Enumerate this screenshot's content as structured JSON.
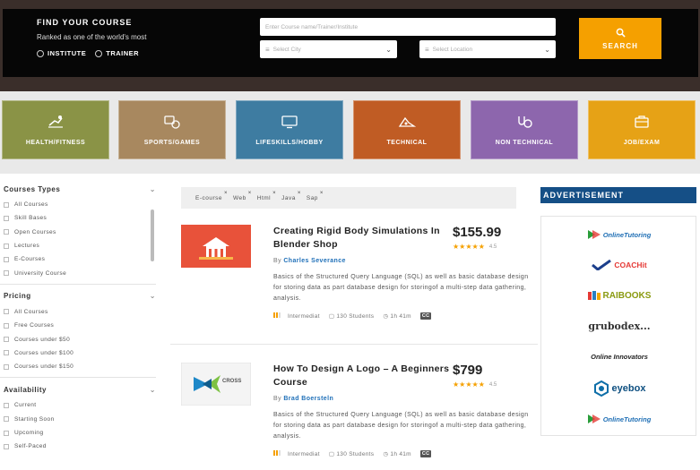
{
  "hero": {
    "title": "FIND YOUR COURSE",
    "subtitle": "Ranked as one of the world's most",
    "radios": [
      "INSTITUTE",
      "TRAINER"
    ],
    "course_placeholder": "Enter Course name/Trainer/Institute",
    "city_placeholder": "Select City",
    "location_placeholder": "Select Location",
    "search_label": "SEARCH"
  },
  "categories": [
    {
      "label": "HEALTH/FITNESS",
      "color": "#8a9346",
      "icon": "fitness-icon"
    },
    {
      "label": "SPORTS/GAMES",
      "color": "#a8885f",
      "icon": "sports-icon"
    },
    {
      "label": "LIFESKILLS/HOBBY",
      "color": "#3e7ca1",
      "icon": "monitor-icon"
    },
    {
      "label": "TECHNICAL",
      "color": "#c05c24",
      "icon": "technical-icon"
    },
    {
      "label": "NON TECHNICAL",
      "color": "#8d66ad",
      "icon": "non-technical-icon"
    },
    {
      "label": "JOB/EXAM",
      "color": "#e6a216",
      "icon": "job-icon"
    }
  ],
  "sidebar": {
    "sections": [
      {
        "title": "Courses Types",
        "items": [
          "All Courses",
          "Skill Bases",
          "Open Courses",
          "Lectures",
          "E-Courses",
          "University Course"
        ]
      },
      {
        "title": "Pricing",
        "items": [
          "All Courses",
          "Free Courses",
          "Courses under $50",
          "Courses under $100",
          "Courses under $150"
        ]
      },
      {
        "title": "Availability",
        "items": [
          "Current",
          "Starting Soon",
          "Upcoming",
          "Self-Paced"
        ]
      }
    ]
  },
  "tags": [
    "E-course",
    "Web",
    "Html",
    "Java",
    "Sap"
  ],
  "courses": [
    {
      "title": "Creating Rigid Body Simulations In Blender Shop",
      "price": "$155.99",
      "stars": "★★★★★",
      "rating": "4.5",
      "by_prefix": "By",
      "author": "Charles Severance",
      "description": "Basics of the Structured Query Language (SQL) as well as basic database design for storing data as part database design for storingof a multi-step data gathering, analysis.",
      "level": "Intermediat",
      "students": "130 Students",
      "duration": "1h 41m",
      "cc": "CC"
    },
    {
      "title": "How To Design A Logo – A Beginners Course",
      "price": "$799",
      "stars": "★★★★★",
      "rating": "4.5",
      "by_prefix": "By",
      "author": "Brad Boersteln",
      "description": "Basics of the Structured Query Language (SQL) as well as basic database design for storing data as part database design for storingof a multi-step data gathering, analysis.",
      "level": "Intermediat",
      "students": "130 Students",
      "duration": "1h 41m",
      "cc": "CC"
    }
  ],
  "ads": {
    "title": "ADVERTISEMENT",
    "logos": [
      "OnlineTutoring",
      "COACHit",
      "RAIBOOKS",
      "grubodex...",
      "Online Innovators",
      "eyebox",
      "OnlineTutoring"
    ]
  }
}
